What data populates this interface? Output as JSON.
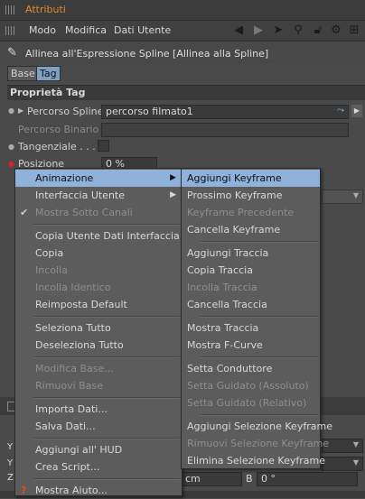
{
  "window": {
    "title": "Attributi"
  },
  "menubar": {
    "items": [
      "Modo",
      "Modifica",
      "Dati Utente"
    ]
  },
  "toolbar_icons": [
    "back-arrow-icon",
    "forward-arrow-icon",
    "cursor-icon",
    "search-icon",
    "lock-icon",
    "settings-icon",
    "new-window-icon"
  ],
  "object": {
    "title": "Allinea all'Espressione Spline [Allinea alla Spline]"
  },
  "tabs": {
    "base": "Base",
    "tag": "Tag"
  },
  "section": {
    "title": "Proprietà Tag"
  },
  "props": {
    "percorso_spline_label": "Percorso Spline",
    "percorso_spline_value": "percorso filmato1",
    "percorso_binario_label": "Percorso Binario",
    "tangenziale_label": "Tangenziale . . . .",
    "posizione_label": "Posizione",
    "posizione_value": "0 %",
    "bottom_field_value": "cm",
    "b_label": "B",
    "b_value": "0 °"
  },
  "context_menu": {
    "items": [
      {
        "label": "Animazione",
        "type": "submenu",
        "state": "highlighted"
      },
      {
        "label": "Interfaccia Utente",
        "type": "submenu",
        "state": "normal"
      },
      {
        "label": "Mostra Sotto Canali",
        "type": "check",
        "state": "disabled"
      },
      {
        "type": "separator"
      },
      {
        "label": "Copia Utente Dati Interfaccia",
        "state": "normal"
      },
      {
        "label": "Copia",
        "state": "normal"
      },
      {
        "label": "Incolla",
        "state": "disabled"
      },
      {
        "label": "Incolla Identico",
        "state": "disabled"
      },
      {
        "label": "Reimposta Default",
        "state": "normal"
      },
      {
        "type": "separator"
      },
      {
        "label": "Seleziona Tutto",
        "state": "normal"
      },
      {
        "label": "Deseleziona Tutto",
        "state": "normal"
      },
      {
        "type": "separator"
      },
      {
        "label": "Modifica Base...",
        "state": "disabled"
      },
      {
        "label": "Rimuovi Base",
        "state": "disabled"
      },
      {
        "type": "separator"
      },
      {
        "label": "Importa Dati...",
        "state": "normal"
      },
      {
        "label": "Salva Dati...",
        "state": "normal"
      },
      {
        "type": "separator"
      },
      {
        "label": "Aggiungi all' HUD",
        "state": "normal"
      },
      {
        "label": "Crea Script...",
        "state": "normal"
      },
      {
        "type": "separator"
      },
      {
        "label": "Mostra Aiuto...",
        "state": "normal",
        "icon": "help-icon"
      }
    ]
  },
  "submenu": {
    "items": [
      {
        "label": "Aggiungi Keyframe",
        "state": "highlighted"
      },
      {
        "label": "Prossimo Keyframe",
        "state": "normal"
      },
      {
        "label": "Keyframe Precedente",
        "state": "disabled"
      },
      {
        "label": "Cancella Keyframe",
        "state": "normal"
      },
      {
        "type": "separator"
      },
      {
        "label": "Aggiungi Traccia",
        "state": "normal"
      },
      {
        "label": "Copia Traccia",
        "state": "normal"
      },
      {
        "label": "Incolla Traccia",
        "state": "disabled"
      },
      {
        "label": "Cancella Traccia",
        "state": "normal"
      },
      {
        "type": "separator"
      },
      {
        "label": "Mostra Traccia",
        "state": "normal"
      },
      {
        "label": "Mostra F-Curve",
        "state": "normal"
      },
      {
        "type": "separator"
      },
      {
        "label": "Setta Conduttore",
        "state": "normal"
      },
      {
        "label": "Setta Guidato (Assoluto)",
        "state": "disabled"
      },
      {
        "label": "Setta Guidato (Relativo)",
        "state": "disabled"
      },
      {
        "type": "separator"
      },
      {
        "label": "Aggiungi Selezione Keyframe",
        "state": "normal"
      },
      {
        "label": "Rimuovi Selezione Keyframe",
        "state": "disabled"
      },
      {
        "label": "Elimina Selezione Keyframe",
        "state": "normal"
      }
    ]
  },
  "colors": {
    "accent": "#e08a2c",
    "highlight": "#8fb1da",
    "tag_tab": "#7fa0c4"
  }
}
